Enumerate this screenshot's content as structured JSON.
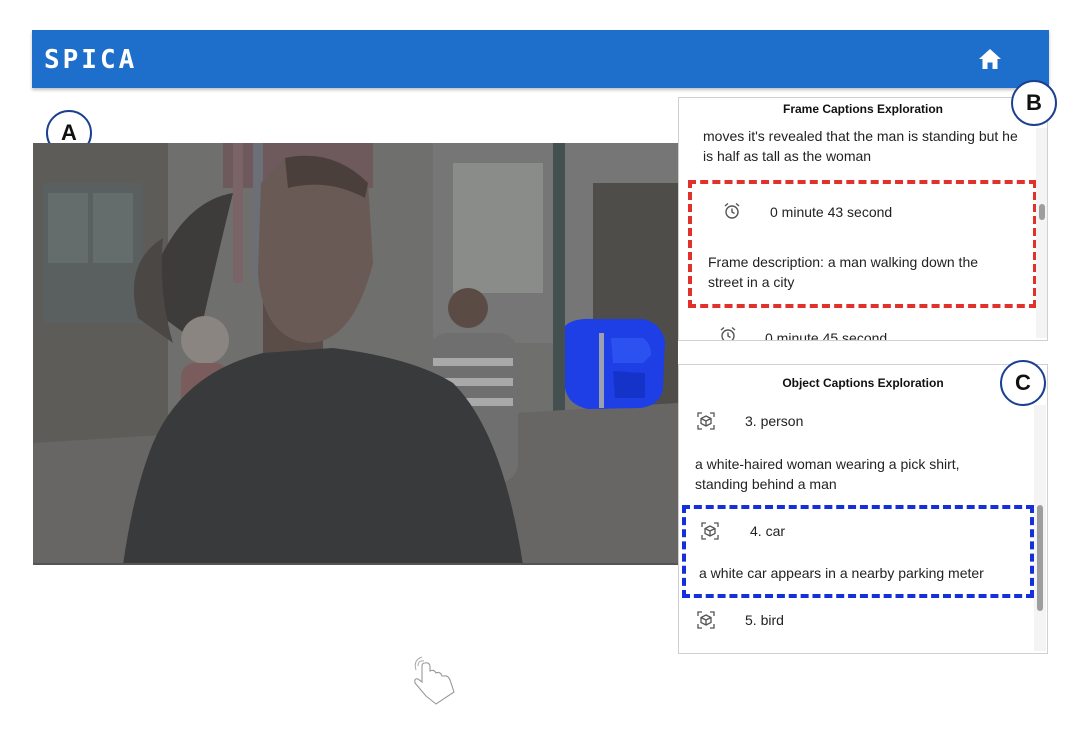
{
  "app": {
    "brand": "SPICA",
    "home_icon": "home-icon"
  },
  "markers": {
    "a": "A",
    "b": "B",
    "c": "C"
  },
  "frame_panel": {
    "title": "Frame Captions Exploration",
    "prev_text_line1": "moves it's revealed that the man is standing but he",
    "prev_text_line2": "is half as tall as the woman",
    "selected": {
      "time": "0 minute 43 second",
      "description_line1": "Frame description: a man walking down the",
      "description_line2": "street in a city"
    },
    "next_time": "0 minute 45 second"
  },
  "object_panel": {
    "title": "Object Captions Exploration",
    "items": [
      {
        "label": "3. person",
        "line1": "a white-haired woman wearing a pick shirt,",
        "line2": "standing behind a man"
      },
      {
        "label": "4. car",
        "line1": "a white car appears in a nearby parking meter"
      },
      {
        "label": "5. bird"
      }
    ]
  },
  "colors": {
    "appbar": "#1e6fcc",
    "highlight_red": "#e0322a",
    "highlight_blue": "#1530d8",
    "marker_border": "#1b3f91"
  }
}
